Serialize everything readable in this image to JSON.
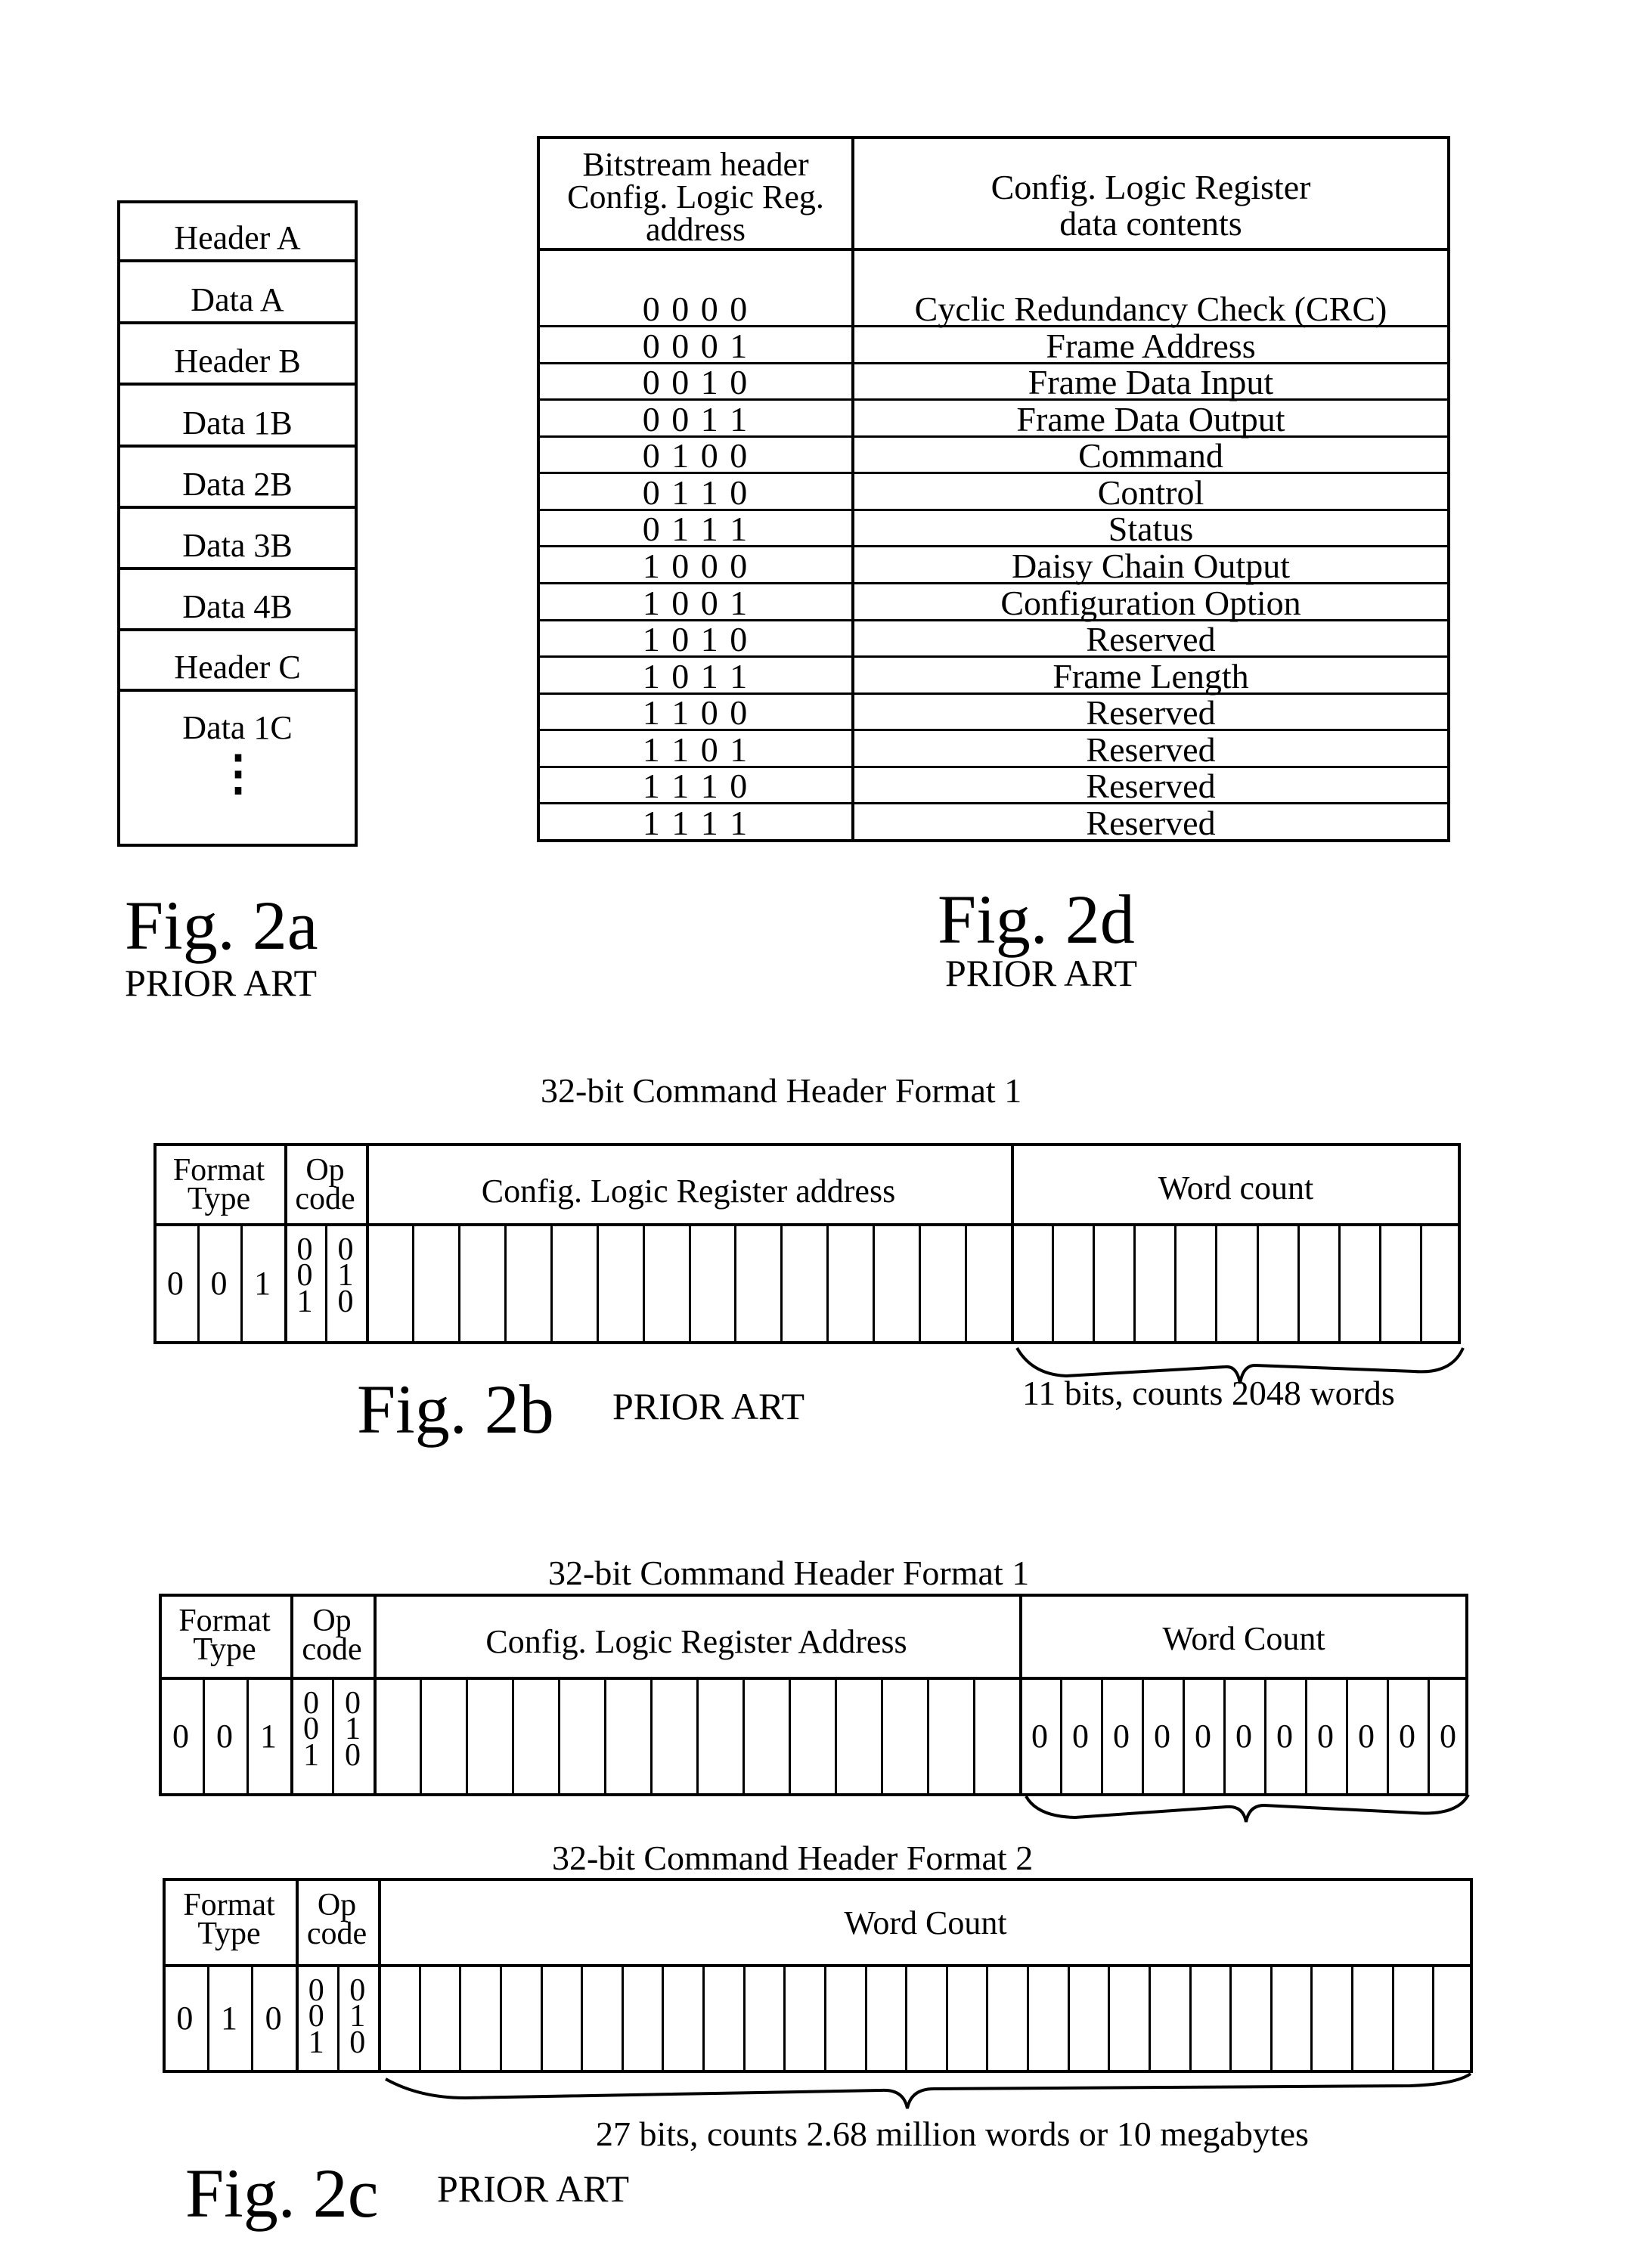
{
  "fig2a": {
    "rows": [
      "Header A",
      "Data A",
      "Header B",
      "Data 1B",
      "Data 2B",
      "Data 3B",
      "Data 4B",
      "Header C",
      "Data 1C"
    ],
    "ellipsis": "⋮",
    "fig_label": "Fig. 2a",
    "prior_art": "PRIOR ART"
  },
  "fig2d": {
    "header_address": [
      "Bitstream header",
      "Config. Logic Reg.",
      "address"
    ],
    "header_contents": [
      "Config. Logic Register",
      "data contents"
    ],
    "rows": [
      {
        "address": "0 0 0 0",
        "contents": "Cyclic Redundancy Check (CRC)"
      },
      {
        "address": "0 0 0 1",
        "contents": "Frame Address"
      },
      {
        "address": "0 0 1 0",
        "contents": "Frame Data Input"
      },
      {
        "address": "0 0 1 1",
        "contents": "Frame Data Output"
      },
      {
        "address": "0 1 0 0",
        "contents": "Command"
      },
      {
        "address": "0 1 1 0",
        "contents": "Control"
      },
      {
        "address": "0 1 1 1",
        "contents": "Status"
      },
      {
        "address": "1 0 0 0",
        "contents": "Daisy Chain Output"
      },
      {
        "address": "1 0 0 1",
        "contents": "Configuration Option"
      },
      {
        "address": "1 0 1 0",
        "contents": "Reserved"
      },
      {
        "address": "1 0 1 1",
        "contents": "Frame Length"
      },
      {
        "address": "1 1 0 0",
        "contents": "Reserved"
      },
      {
        "address": "1 1 0 1",
        "contents": "Reserved"
      },
      {
        "address": "1 1 1 0",
        "contents": "Reserved"
      },
      {
        "address": "1 1 1 1",
        "contents": "Reserved"
      }
    ],
    "fig_label": "Fig. 2d",
    "prior_art": "PRIOR ART"
  },
  "fig2b": {
    "title": "32-bit Command Header Format 1",
    "format_type_label": [
      "Format",
      "Type"
    ],
    "opcode_label": [
      "Op",
      "code"
    ],
    "field_label": "Config. Logic Register address",
    "word_count_label": "Word count",
    "format_bits": [
      "0",
      "0",
      "1"
    ],
    "opcode_bits": [
      [
        "0",
        "0",
        "1"
      ],
      [
        "0",
        "1",
        "0"
      ]
    ],
    "address_bit_count": 14,
    "word_count_bits": [
      "",
      "",
      "",
      "",
      "",
      "",
      "",
      "",
      "",
      "",
      ""
    ],
    "brace_note": "11 bits, counts 2048 words",
    "fig_label": "Fig. 2b",
    "prior_art": "PRIOR ART"
  },
  "fig2c": {
    "format1": {
      "title": "32-bit Command Header Format 1",
      "format_type_label": [
        "Format",
        "Type"
      ],
      "opcode_label": [
        "Op",
        "code"
      ],
      "field_label": "Config. Logic Register Address",
      "word_count_label": "Word Count",
      "format_bits": [
        "0",
        "0",
        "1"
      ],
      "opcode_bits": [
        [
          "0",
          "0",
          "1"
        ],
        [
          "0",
          "1",
          "0"
        ]
      ],
      "address_bit_count": 14,
      "word_count_bits": [
        "0",
        "0",
        "0",
        "0",
        "0",
        "0",
        "0",
        "0",
        "0",
        "0",
        "0"
      ]
    },
    "format2": {
      "title": "32-bit Command Header Format 2",
      "format_type_label": [
        "Format",
        "Type"
      ],
      "opcode_label": [
        "Op",
        "code"
      ],
      "word_count_label": "Word Count",
      "format_bits": [
        "0",
        "1",
        "0"
      ],
      "opcode_bits": [
        [
          "0",
          "0",
          "1"
        ],
        [
          "0",
          "1",
          "0"
        ]
      ],
      "word_count_bit_count": 27,
      "brace_note": "27 bits, counts 2.68 million words or 10 megabytes"
    },
    "fig_label": "Fig. 2c",
    "prior_art": "PRIOR ART"
  }
}
